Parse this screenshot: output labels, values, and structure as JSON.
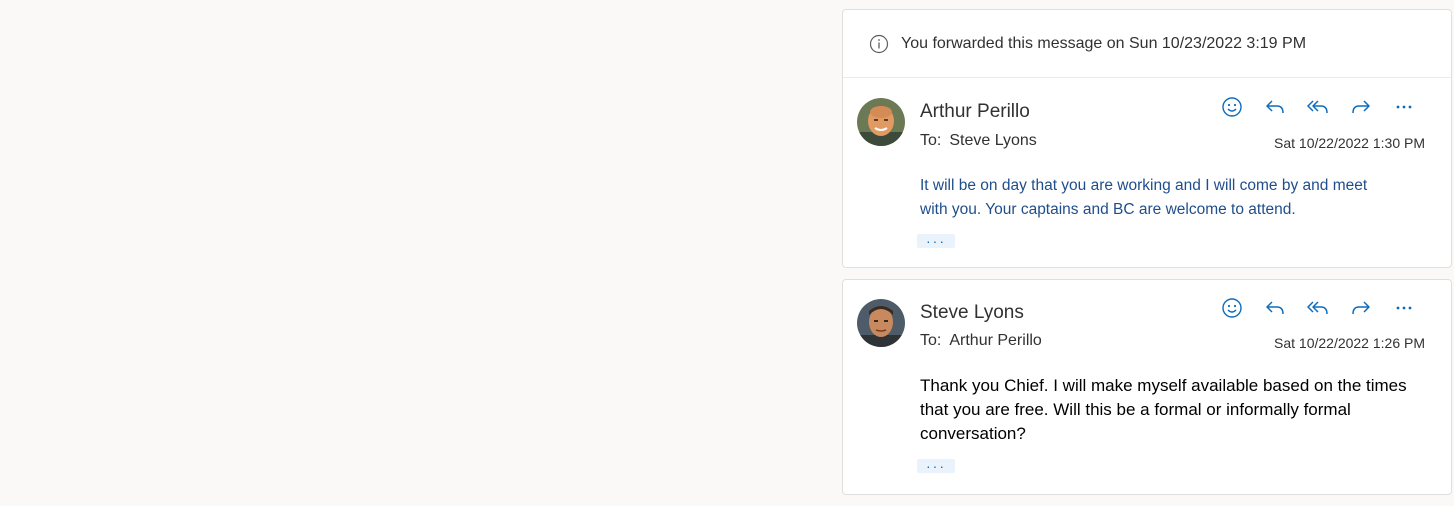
{
  "banner": {
    "text": "You forwarded this message on Sun 10/23/2022 3:19 PM"
  },
  "messages": [
    {
      "sender": "Arthur Perillo",
      "to_label": "To:",
      "recipient": "Steve Lyons",
      "date": "Sat 10/22/2022 1:30 PM",
      "body_lines": [
        "It will be on day that you are working and I will come by and meet",
        "with you.  Your captains and BC are welcome to attend."
      ],
      "more_label": "···",
      "avatar_colors": {
        "bg": "#5c6b4e",
        "face": "#e0a070"
      }
    },
    {
      "sender": "Steve Lyons",
      "to_label": "To:",
      "recipient": "Arthur Perillo",
      "date": "Sat 10/22/2022 1:26 PM",
      "body_lines": [
        "Thank you Chief. I will make myself available based on the times",
        "that you are free. Will this be a formal or informally formal",
        "conversation?"
      ],
      "more_label": "···",
      "avatar_colors": {
        "bg": "#4a5a66",
        "face": "#c58a64"
      }
    }
  ],
  "actions": [
    "emoji-react-icon",
    "reply-icon",
    "reply-all-icon",
    "forward-icon",
    "more-icon"
  ],
  "colors": {
    "accent": "#0f6cbd",
    "body_blue": "#1f4e8c",
    "background": "#faf9f8"
  }
}
